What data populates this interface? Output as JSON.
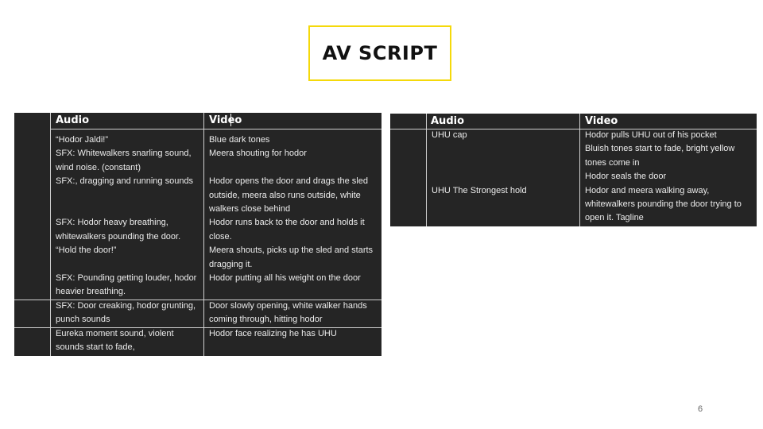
{
  "slide": {
    "title": "AV SCRIPT",
    "page_number": "6"
  },
  "left_table": {
    "header_audio": "Audio",
    "header_video": "Video",
    "rows": [
      {
        "audio": "“Hodor Jaldi!”\nSFX: Whitewalkers snarling sound, wind noise. (constant)\nSFX:, dragging and running sounds\n\n\nSFX: Hodor heavy breathing, whitewalkers pounding the door.\n“Hold the door!”\n\nSFX: Pounding getting louder, hodor heavier breathing.",
        "video": "Blue dark tones\nMeera shouting for hodor\n\nHodor opens the door and drags the sled outside, meera also runs outside, white walkers close behind\nHodor runs back to the door and holds it close.\nMeera shouts, picks up the sled and starts dragging it.\nHodor putting all his weight on the door"
      },
      {
        "audio": "SFX: Door creaking, hodor grunting, punch sounds",
        "video": "Door slowly opening, white walker hands coming through, hitting hodor"
      },
      {
        "audio": "Eureka moment sound, violent sounds start to fade,",
        "video": "Hodor face realizing he has UHU"
      }
    ]
  },
  "right_table": {
    "header_audio": "Audio",
    "header_video": "Video",
    "rows": [
      {
        "audio": "UHU cap\n\n\n\nUHU The Strongest hold",
        "video": "Hodor pulls UHU out of his pocket\nBluish tones start to fade, bright yellow tones come in\nHodor seals the door\nHodor and meera walking away, whitewalkers pounding the door trying to open it. Tagline"
      }
    ]
  }
}
